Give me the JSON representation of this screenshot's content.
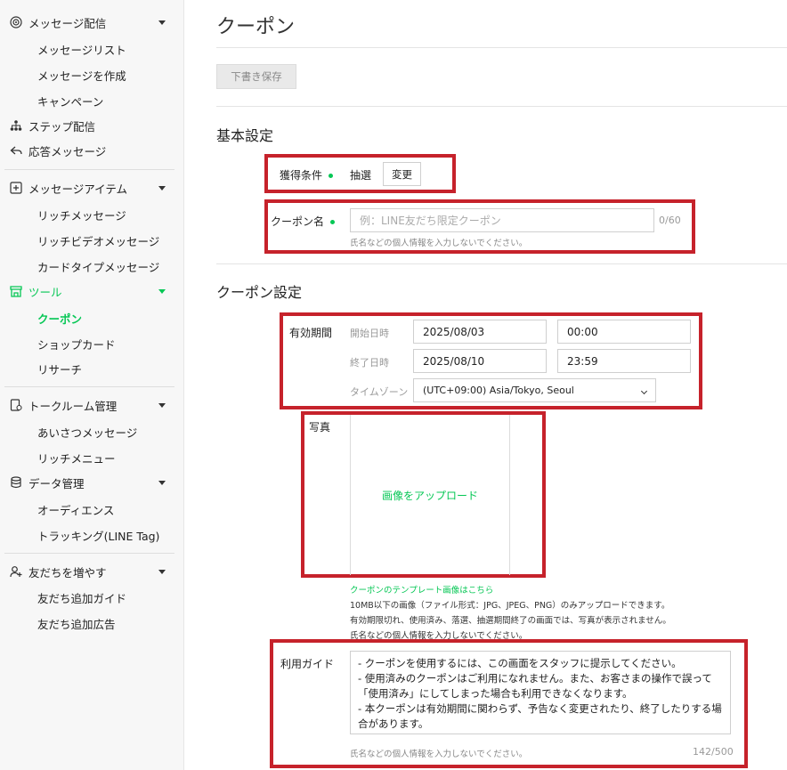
{
  "sidebar": {
    "sections": [
      {
        "label": "メッセージ配信",
        "icon": "broadcast-icon",
        "items": [
          "メッセージリスト",
          "メッセージを作成",
          "キャンペーン"
        ]
      },
      {
        "label": "ステップ配信",
        "icon": "step-icon"
      },
      {
        "label": "応答メッセージ",
        "icon": "reply-icon"
      },
      {
        "label": "メッセージアイテム",
        "icon": "message-item-icon",
        "items": [
          "リッチメッセージ",
          "リッチビデオメッセージ",
          "カードタイプメッセージ"
        ]
      },
      {
        "label": "ツール",
        "icon": "store-icon",
        "items": [
          "クーポン",
          "ショップカード",
          "リサーチ"
        ]
      },
      {
        "label": "トークルーム管理",
        "icon": "talkroom-icon",
        "items": [
          "あいさつメッセージ",
          "リッチメニュー"
        ]
      },
      {
        "label": "データ管理",
        "icon": "database-icon",
        "items": [
          "オーディエンス",
          "トラッキング(LINE Tag)"
        ]
      },
      {
        "label": "友だちを増やす",
        "icon": "add-friend-icon",
        "items": [
          "友だち追加ガイド",
          "友だち追加広告"
        ]
      }
    ]
  },
  "header": {
    "title": "クーポン",
    "draft_save": "下書き保存"
  },
  "basic": {
    "title": "基本設定",
    "condition_label": "獲得条件",
    "condition_value": "抽選",
    "change_btn": "変更",
    "name_label": "クーポン名",
    "name_placeholder": "例：LINE友だち限定クーポン",
    "name_counter": "0/60",
    "name_hint": "氏名などの個人情報を入力しないでください。"
  },
  "coupon": {
    "title": "クーポン設定",
    "period_label": "有効期間",
    "start_label": "開始日時",
    "start_date": "2025/08/03",
    "start_time": "00:00",
    "end_label": "終了日時",
    "end_date": "2025/08/10",
    "end_time": "23:59",
    "tz_label": "タイムゾーン",
    "tz_value": "(UTC+09:00) Asia/Tokyo, Seoul",
    "photo_label": "写真",
    "upload_text": "画像をアップロード",
    "template_link": "クーポンのテンプレート画像はこちら",
    "photo_note1": "10MB以下の画像（ファイル形式：JPG、JPEG、PNG）のみアップロードできます。",
    "photo_note2": "有効期限切れ、使用済み、落選、抽選期間終了の画面では、写真が表示されません。",
    "photo_note3": "氏名などの個人情報を入力しないでください。",
    "guide_label": "利用ガイド",
    "guide_lines": [
      "- クーポンを使用するには、この画面をスタッフに提示してください。",
      "- 使用済みのクーポンはご利用になれません。また、お客さまの操作で誤って",
      "「使用済み」にしてしまった場合も利用できなくなります。",
      "- 本クーポンは有効期間に関わらず、予告なく変更されたり、終了したりする場",
      "合があります。"
    ],
    "guide_hint": "氏名などの個人情報を入力しないでください。",
    "guide_counter": "142/500"
  },
  "colors": {
    "accent": "#06c755",
    "highlight": "#c6222b"
  }
}
